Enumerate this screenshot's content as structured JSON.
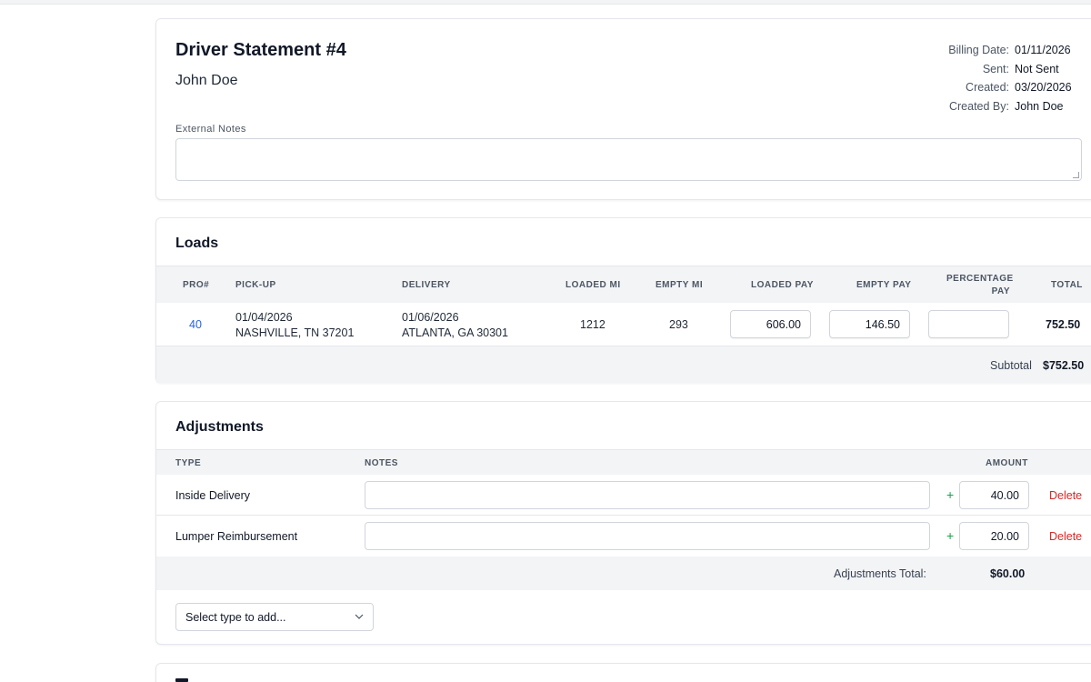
{
  "statement": {
    "title": "Driver Statement #4",
    "driver": "John Doe",
    "meta": [
      {
        "label": "Billing Date:",
        "value": "01/11/2026"
      },
      {
        "label": "Sent:",
        "value": "Not Sent"
      },
      {
        "label": "Created:",
        "value": "03/20/2026"
      },
      {
        "label": "Created By:",
        "value": "John Doe"
      }
    ],
    "external_notes_label": "External Notes",
    "external_notes_value": ""
  },
  "loads": {
    "title": "Loads",
    "columns": {
      "pro": "PRO#",
      "pickup": "PICK-UP",
      "delivery": "DELIVERY",
      "loaded_mi": "LOADED MI",
      "empty_mi": "EMPTY MI",
      "loaded_pay": "LOADED PAY",
      "empty_pay": "EMPTY PAY",
      "percentage_pay_1": "PERCENTAGE",
      "percentage_pay_2": "PAY",
      "total": "TOTAL"
    },
    "rows": [
      {
        "pro": "40",
        "pickup_date": "01/04/2026",
        "pickup_location": "NASHVILLE, TN 37201",
        "delivery_date": "01/06/2026",
        "delivery_location": "ATLANTA, GA 30301",
        "loaded_mi": "1212",
        "empty_mi": "293",
        "loaded_pay": "606.00",
        "empty_pay": "146.50",
        "percentage_pay": "",
        "total": "752.50"
      }
    ],
    "subtotal_label": "Subtotal",
    "subtotal_value": "$752.50"
  },
  "adjustments": {
    "title": "Adjustments",
    "columns": {
      "type": "TYPE",
      "notes": "NOTES",
      "amount": "AMOUNT"
    },
    "rows": [
      {
        "type": "Inside Delivery",
        "notes": "",
        "sign": "+",
        "amount": "40.00",
        "delete_label": "Delete"
      },
      {
        "type": "Lumper Reimbursement",
        "notes": "",
        "sign": "+",
        "amount": "20.00",
        "delete_label": "Delete"
      }
    ],
    "total_label": "Adjustments Total:",
    "total_value": "$60.00",
    "add_select_label": "Select type to add..."
  },
  "colors": {
    "link": "#2563eb",
    "delete": "#dc2626",
    "plus": "#16a34a",
    "table_header_bg": "#f3f4f6"
  }
}
